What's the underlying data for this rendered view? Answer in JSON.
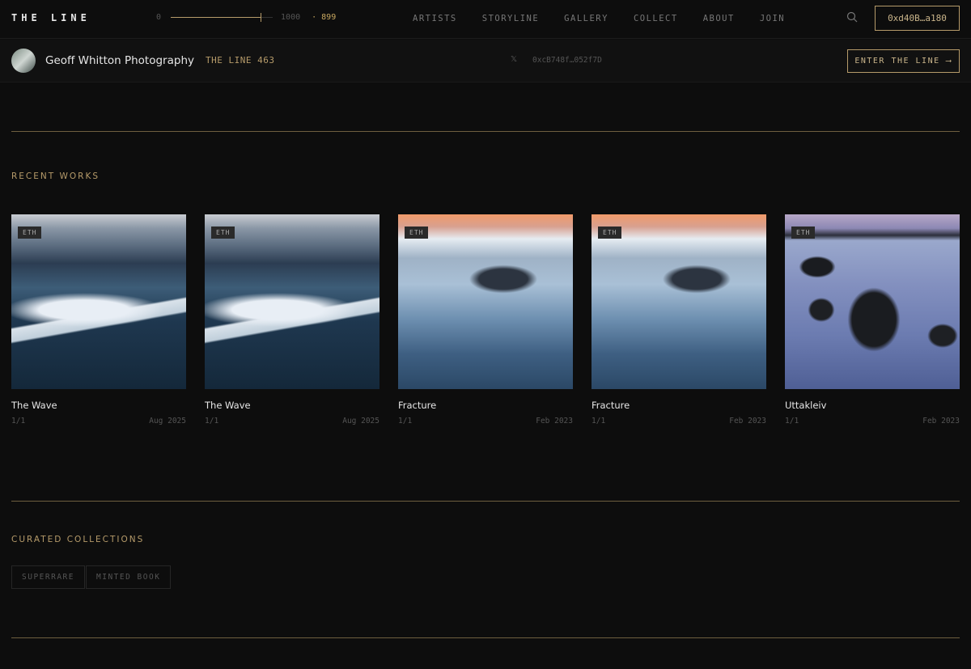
{
  "header": {
    "logo": "THE LINE",
    "slider": {
      "min": "0",
      "max": "1000",
      "value": "· 899",
      "fraction": 0.899
    },
    "nav": [
      "ARTISTS",
      "STORYLINE",
      "GALLERY",
      "COLLECT",
      "ABOUT",
      "JOIN"
    ],
    "wallet": "0xd40B…a180"
  },
  "artist_bar": {
    "name": "Geoff Whitton Photography",
    "separator": "·",
    "line_number": "THE LINE 463",
    "x_icon": "𝕏",
    "address": "0xcB748f…052f7D",
    "enter_label": "ENTER THE LINE ⟶"
  },
  "recent": {
    "heading": "RECENT WORKS",
    "works": [
      {
        "badge": "ETH",
        "title": "The Wave",
        "edition": "1/1",
        "date": "Aug 2025"
      },
      {
        "badge": "ETH",
        "title": "The Wave",
        "edition": "1/1",
        "date": "Aug 2025"
      },
      {
        "badge": "ETH",
        "title": "Fracture",
        "edition": "1/1",
        "date": "Feb 2023"
      },
      {
        "badge": "ETH",
        "title": "Fracture",
        "edition": "1/1",
        "date": "Feb 2023"
      },
      {
        "badge": "ETH",
        "title": "Uttakleiv",
        "edition": "1/1",
        "date": "Feb 2023"
      }
    ]
  },
  "collections": {
    "heading": "CURATED COLLECTIONS",
    "items": [
      "SUPERRARE",
      "MINTED BOOK"
    ]
  },
  "colors": {
    "accent": "#b69b6a",
    "background": "#0d0d0d"
  }
}
